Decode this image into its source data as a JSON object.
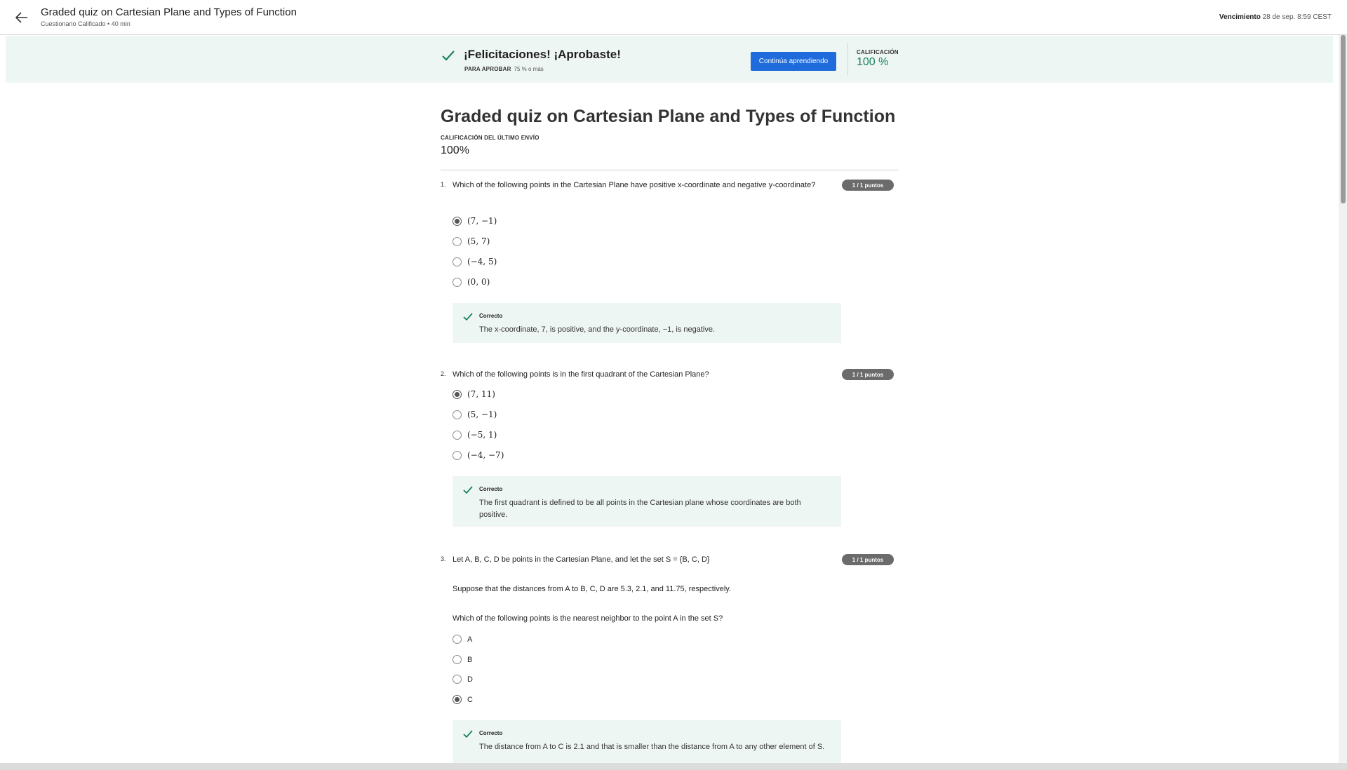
{
  "header": {
    "title": "Graded quiz on Cartesian Plane and Types of Function",
    "subtitle": "Cuestionario Calificado • 40 min",
    "due_label": "Vencimiento",
    "due_value": "28 de sep. 8:59 CEST"
  },
  "banner": {
    "title": "¡Felicitaciones! ¡Aprobaste!",
    "pass_label": "PARA APROBAR",
    "pass_value": "75 % o más",
    "continue_button": "Continúa aprendiendo",
    "grade_label": "CALIFICACIÓN",
    "grade_value": "100 %"
  },
  "quiz": {
    "title": "Graded quiz on Cartesian Plane and Types of Function",
    "last_label": "CALIFICACIÓN DEL ÚLTIMO ENVÍO",
    "last_value": "100%"
  },
  "questions": [
    {
      "number": "1.",
      "text": "Which of the following points in the Cartesian Plane have positive x-coordinate and negative y-coordinate?",
      "badge": "1 / 1 puntos",
      "options": [
        "(7, −1)",
        "(5, 7)",
        "(−4, 5)",
        "(0, 0)"
      ],
      "selected": 0,
      "feedback_title": "Correcto",
      "feedback_text": "The x-coordinate, 7, is positive, and the y-coordinate, −1, is negative."
    },
    {
      "number": "2.",
      "text": "Which of the following points is in the first quadrant of the Cartesian Plane?",
      "badge": "1 / 1 puntos",
      "options": [
        "(7, 11)",
        "(5, −1)",
        "(−5, 1)",
        "(−4, −7)"
      ],
      "selected": 0,
      "feedback_title": "Correcto",
      "feedback_text": "The first quadrant is defined to be all points in the Cartesian plane whose coordinates are both positive."
    },
    {
      "number": "3.",
      "text": "Let A, B, C, D be points in the Cartesian Plane, and let the set S = {B, C, D}",
      "text2": "Suppose that the distances from A to B, C, D are 5.3, 2.1, and 11.75, respectively.",
      "text3": "Which of the following points is the nearest neighbor to the point A in the set S?",
      "badge": "1 / 1 puntos",
      "options": [
        "A",
        "B",
        "D",
        "C"
      ],
      "selected": 3,
      "feedback_title": "Correcto",
      "feedback_text": "The distance from A to C is 2.1 and that is smaller than the distance from A to any other element of S."
    }
  ],
  "colors": {
    "accent": "#1f6bdc",
    "success": "#1a8060",
    "banner_bg": "#eef6f3",
    "badge_bg": "#6b6b6b"
  },
  "icons": [
    "back-arrow-icon",
    "check-icon"
  ]
}
